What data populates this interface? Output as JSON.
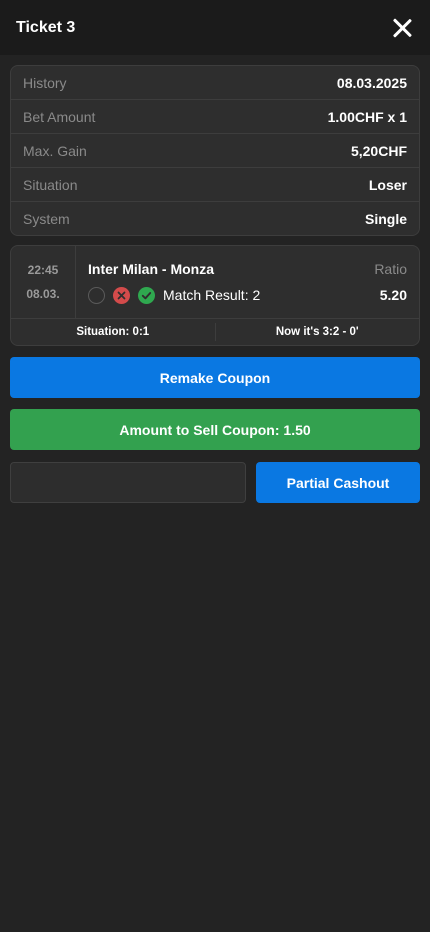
{
  "header": {
    "title": "Ticket 3"
  },
  "info": [
    {
      "label": "History",
      "value": "08.03.2025"
    },
    {
      "label": "Bet Amount",
      "value": "1.00CHF x 1"
    },
    {
      "label": "Max. Gain",
      "value": "5,20CHF"
    },
    {
      "label": "Situation",
      "value": "Loser"
    },
    {
      "label": "System",
      "value": "Single"
    }
  ],
  "match": {
    "time": "22:45",
    "date": "08.03.",
    "teams": "Inter Milan - Monza",
    "ratio_label": "Ratio",
    "selection": "Match Result: 2",
    "ratio_value": "5.20",
    "situation": "Situation: 0:1",
    "now": "Now it's 3:2 - 0'",
    "icons": [
      "pending-circle-icon",
      "lost-x-icon",
      "won-check-icon"
    ]
  },
  "buttons": {
    "remake": "Remake Coupon",
    "sell": "Amount to Sell Coupon: 1.50",
    "partial": "Partial Cashout"
  },
  "cashout_input": {
    "value": "",
    "placeholder": ""
  },
  "colors": {
    "blue": "#0a78e2",
    "green": "#33a14f",
    "red": "#d34b4b",
    "background": "#232323"
  }
}
